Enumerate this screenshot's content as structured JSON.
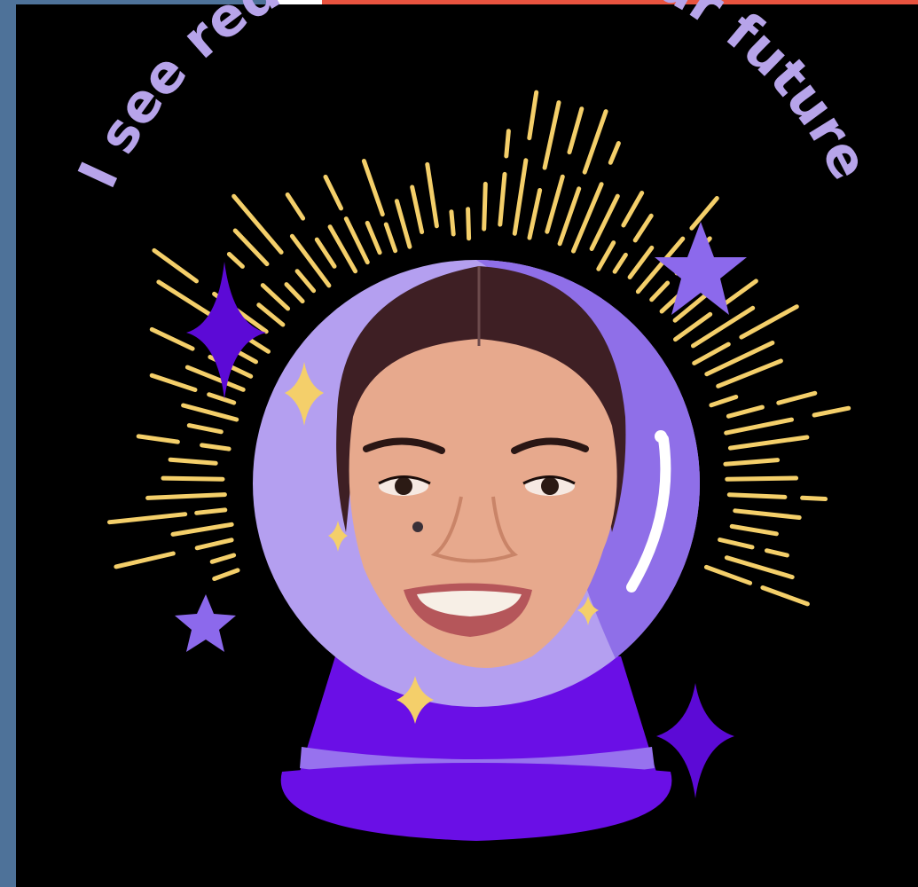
{
  "title": "I see reductions in your future",
  "colors": {
    "background": "#000000",
    "frame_blue": "#4e7299",
    "frame_white": "#ffffff",
    "frame_red": "#e8533f",
    "title": "#b7a4ea",
    "rays": "#f4cf6a",
    "orb_light": "#b49ff0",
    "orb_dark": "#8f6fe8",
    "base": "#6a0fe6",
    "base_band": "#9772ee",
    "star_purple": "#8c69ec",
    "sparkle_dark": "#5c0ad6",
    "skin": "#e7a98d",
    "hair": "#3e1f24"
  },
  "icons": [
    "crystal-ball-icon",
    "star-icon",
    "sparkle-icon"
  ]
}
